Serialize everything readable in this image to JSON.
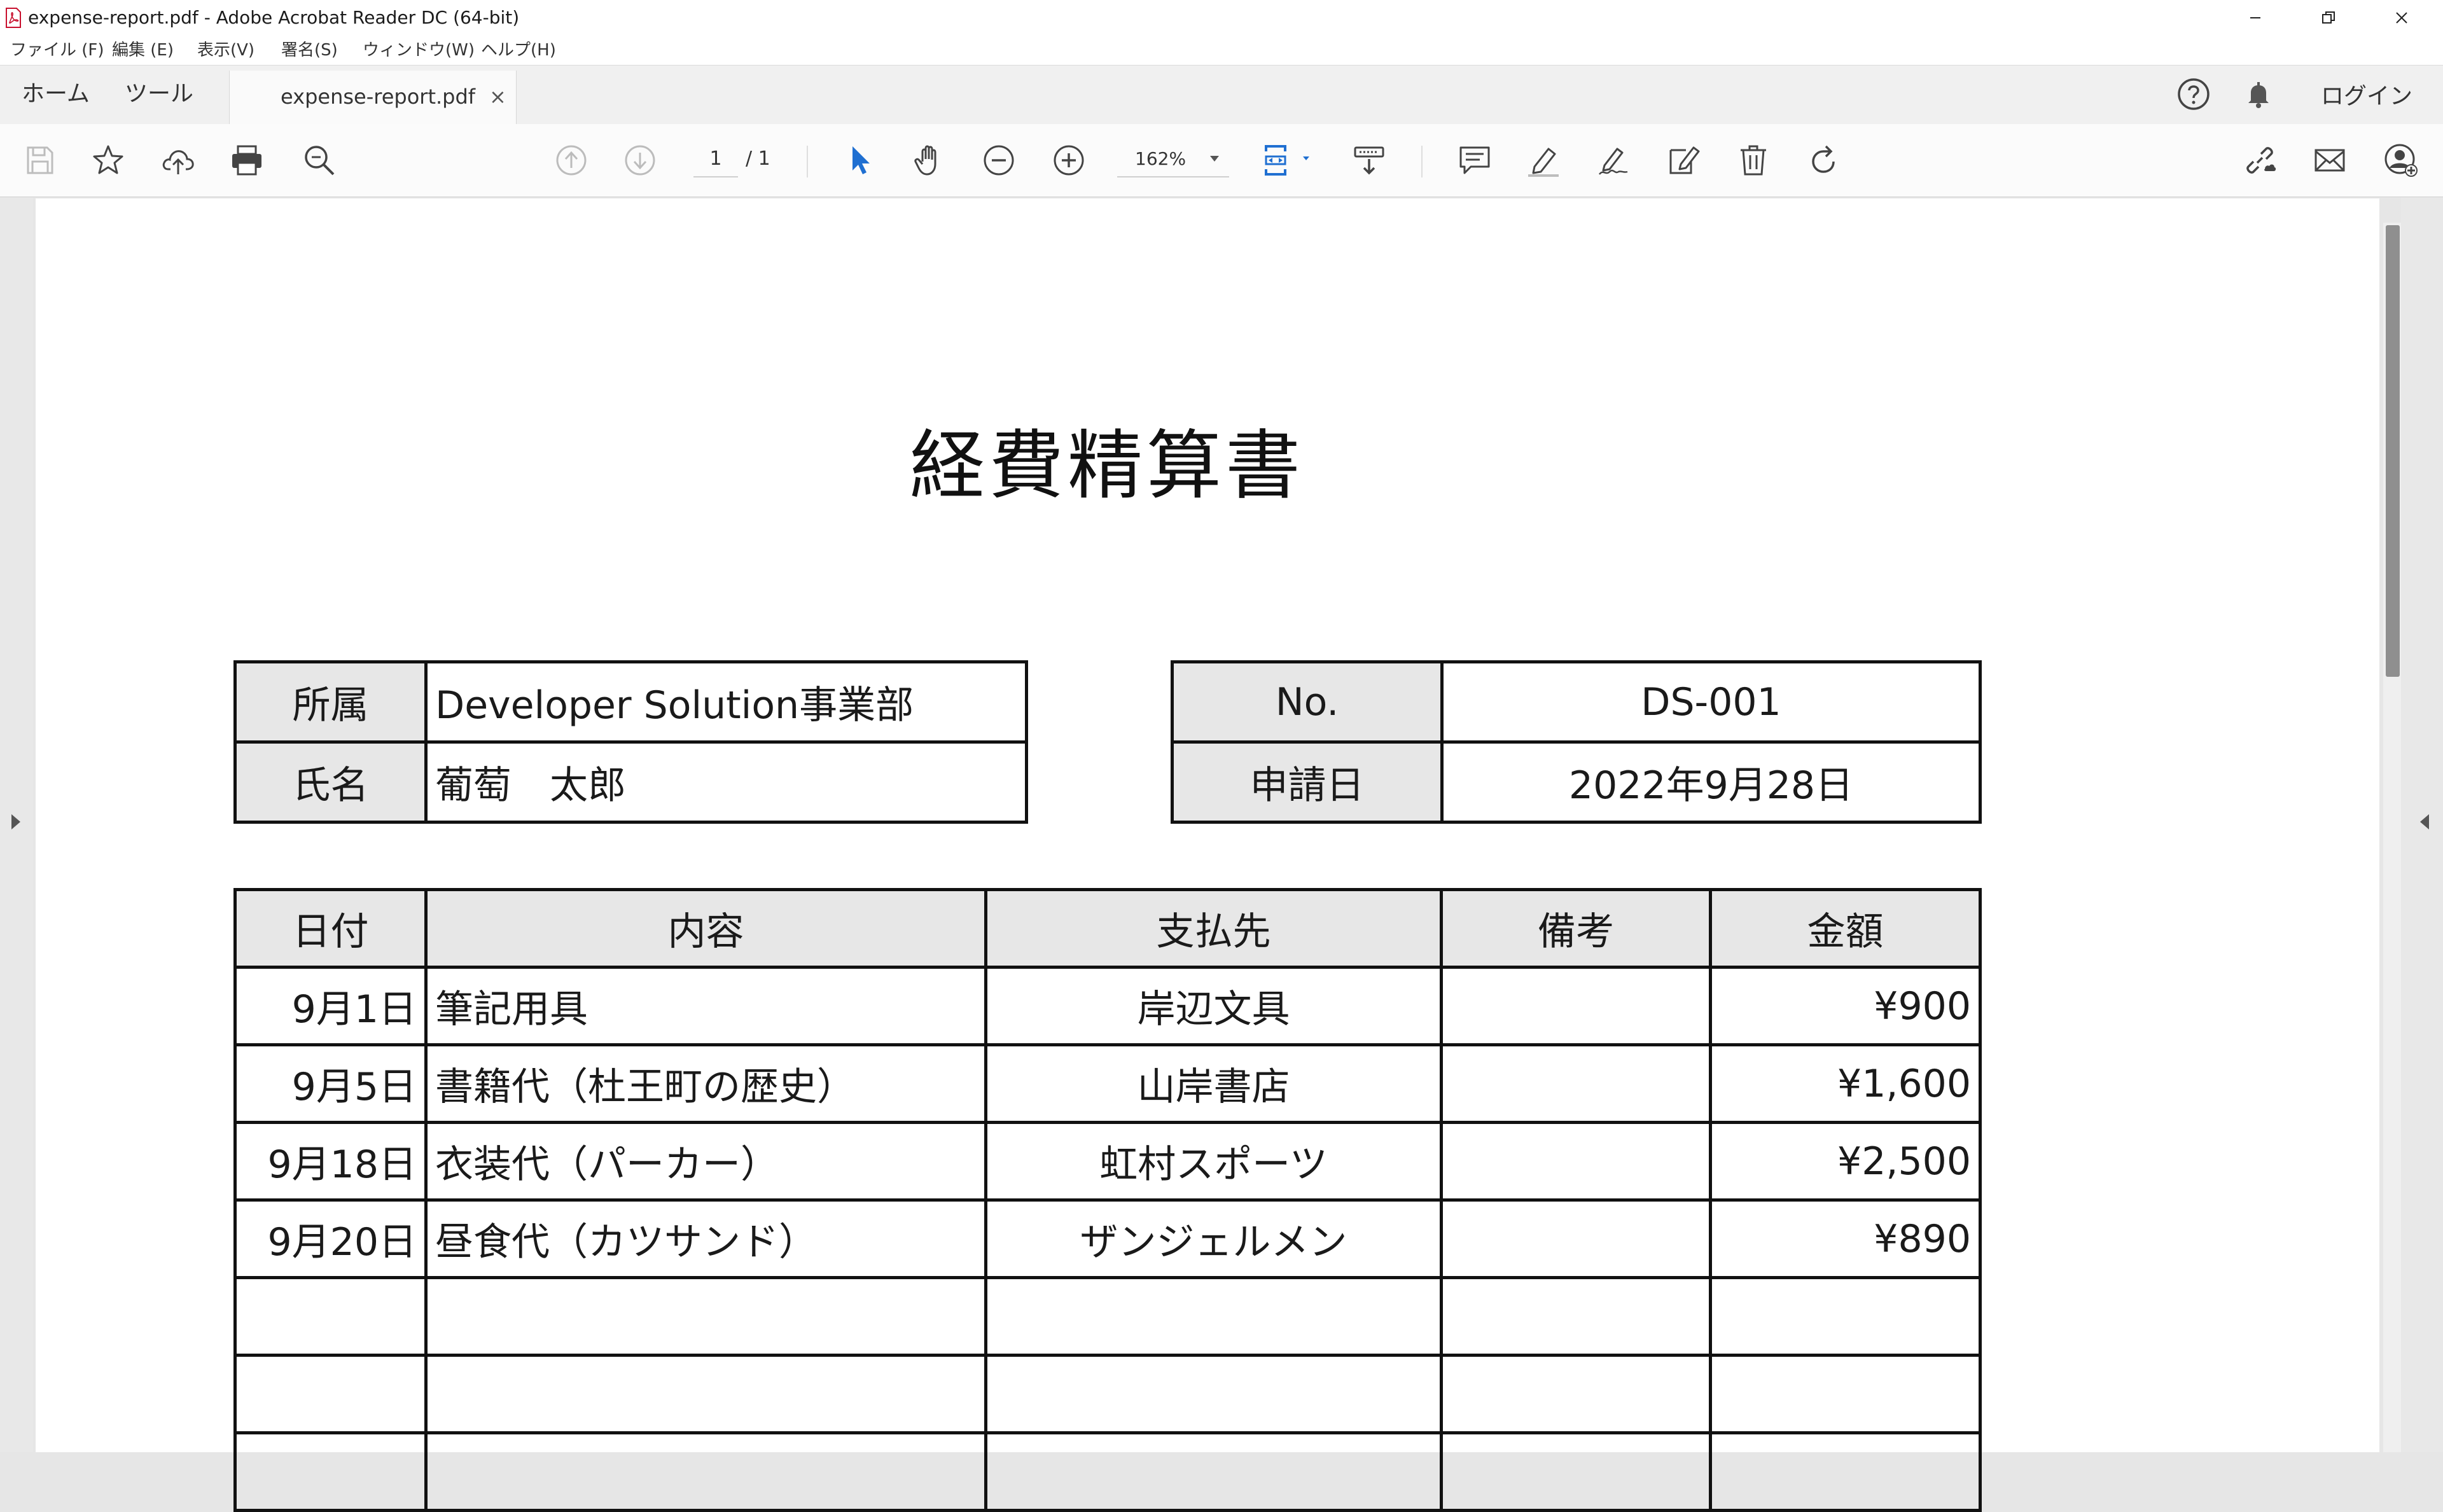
{
  "window": {
    "title": "expense-report.pdf - Adobe Acrobat Reader DC (64-bit)"
  },
  "menu": [
    "ファイル (F)",
    "編集 (E)",
    "表示(V)",
    "署名(S)",
    "ウィンドウ(W)",
    "ヘルプ(H)"
  ],
  "tabs": {
    "home": "ホーム",
    "tools": "ツール",
    "document": "expense-report.pdf"
  },
  "header": {
    "login": "ログイン"
  },
  "toolbar": {
    "page_current": "1",
    "page_total": "/ 1",
    "zoom": "162%"
  },
  "document": {
    "title": "経費精算書",
    "info_left": [
      {
        "label": "所属",
        "value": "Developer Solution事業部"
      },
      {
        "label": "氏名",
        "value": "葡萄　太郎"
      }
    ],
    "info_right": [
      {
        "label": "No.",
        "value": "DS-001"
      },
      {
        "label": "申請日",
        "value": "2022年9月28日"
      }
    ],
    "expense_headers": [
      "日付",
      "内容",
      "支払先",
      "備考",
      "金額"
    ],
    "expense_rows": [
      [
        "9月1日",
        "筆記用具",
        "岸辺文具",
        "",
        "¥900"
      ],
      [
        "9月5日",
        "書籍代（杜王町の歴史）",
        "山岸書店",
        "",
        "¥1,600"
      ],
      [
        "9月18日",
        "衣装代（パーカー）",
        "虹村スポーツ",
        "",
        "¥2,500"
      ],
      [
        "9月20日",
        "昼食代（カツサンド）",
        "ザンジェルメン",
        "",
        "¥890"
      ],
      [
        "",
        "",
        "",
        "",
        ""
      ],
      [
        "",
        "",
        "",
        "",
        ""
      ],
      [
        "",
        "",
        "",
        "",
        ""
      ]
    ]
  },
  "colors": {
    "accent_blue": "#1f6fd1",
    "header_cell_gray": "#e7e7e7",
    "scrollbar_thumb": "#8f8f8f"
  },
  "icons": {
    "toolbar": [
      "save-icon",
      "bookmark-star-icon",
      "cloud-upload-icon",
      "print-icon",
      "search-zoom-icon",
      "page-up-icon",
      "page-down-icon",
      "select-arrow-icon",
      "hand-icon",
      "zoom-out-icon",
      "zoom-in-icon",
      "fit-page-icon",
      "scroll-mode-icon",
      "comment-icon",
      "highlight-icon",
      "sign-icon",
      "edit-icon",
      "delete-icon",
      "rotate-icon",
      "share-link-icon",
      "email-icon",
      "add-user-icon"
    ]
  }
}
